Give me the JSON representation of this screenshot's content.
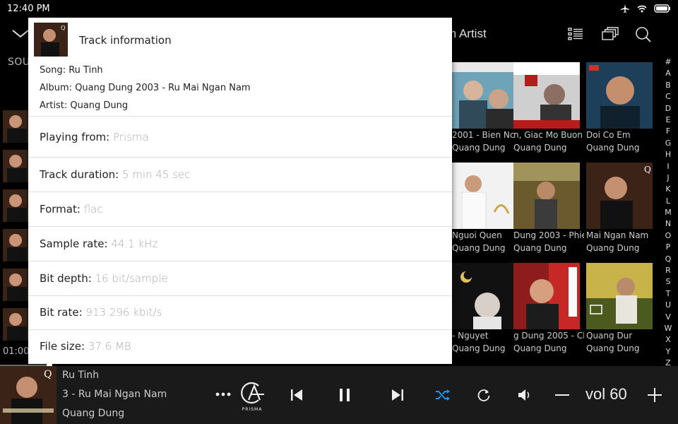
{
  "status": {
    "time": "12:40 PM"
  },
  "header": {
    "title_partial": "m Artist",
    "sources_partial": "SOU"
  },
  "left": {
    "time_partial": "01:00"
  },
  "dialog": {
    "title": "Track information",
    "song_label": "Song:",
    "song": "Ru Tinh",
    "album_label": "Album:",
    "album": "Quang Dung 2003 - Ru Mai Ngan Nam",
    "artist_label": "Artist:",
    "artist": "Quang Dung",
    "rows": [
      {
        "label": "Playing from:",
        "value": "Prisma"
      },
      {
        "label": "Track duration:",
        "value": "5 min 45 sec"
      },
      {
        "label": "Format:",
        "value": "flac"
      },
      {
        "label": "Sample rate:",
        "value": "44.1 kHz"
      },
      {
        "label": "Bit depth:",
        "value": "16 bit/sample"
      },
      {
        "label": "Bit rate:",
        "value": "913.296 kbit/s"
      },
      {
        "label": "File size:",
        "value": "37.6 MB"
      }
    ]
  },
  "albums": [
    {
      "title": "2001 - Bien Nc",
      "artist": "Quang Dung"
    },
    {
      "title": "n, Giac Mo Buon",
      "artist": "Quang Dung"
    },
    {
      "title": "Doi Co Em",
      "artist": "Quang Dung"
    },
    {
      "title": "Nguoi Quen",
      "artist": "Quang Dung"
    },
    {
      "title": "Dung 2003 - Phie",
      "artist": "Quang Dung"
    },
    {
      "title": "Mai Ngan Nam",
      "artist": "Quang Dung"
    },
    {
      "title": "- Nguyet",
      "artist": "Quang Dung"
    },
    {
      "title": "g Dung 2005 - Ch",
      "artist": "Quang Dung"
    },
    {
      "title": "Quang Dur",
      "artist": "Quang Dung"
    }
  ],
  "alphabet": [
    "#",
    "A",
    "B",
    "C",
    "D",
    "E",
    "F",
    "G",
    "H",
    "I",
    "J",
    "K",
    "L",
    "M",
    "N",
    "O",
    "P",
    "Q",
    "R",
    "S",
    "T",
    "U",
    "V",
    "W",
    "X",
    "Y",
    "Z"
  ],
  "player": {
    "track": "Ru Tinh",
    "album": "3 - Ru Mai Ngan Nam",
    "artist": "Quang Dung",
    "logo_text": "PRISMA",
    "volume": "vol 60"
  },
  "colors": {
    "accent": "#2196f3",
    "dialog_bg": "#ffffff",
    "player_bg": "#1a1a1a",
    "value_grey": "#aaaaaa"
  }
}
